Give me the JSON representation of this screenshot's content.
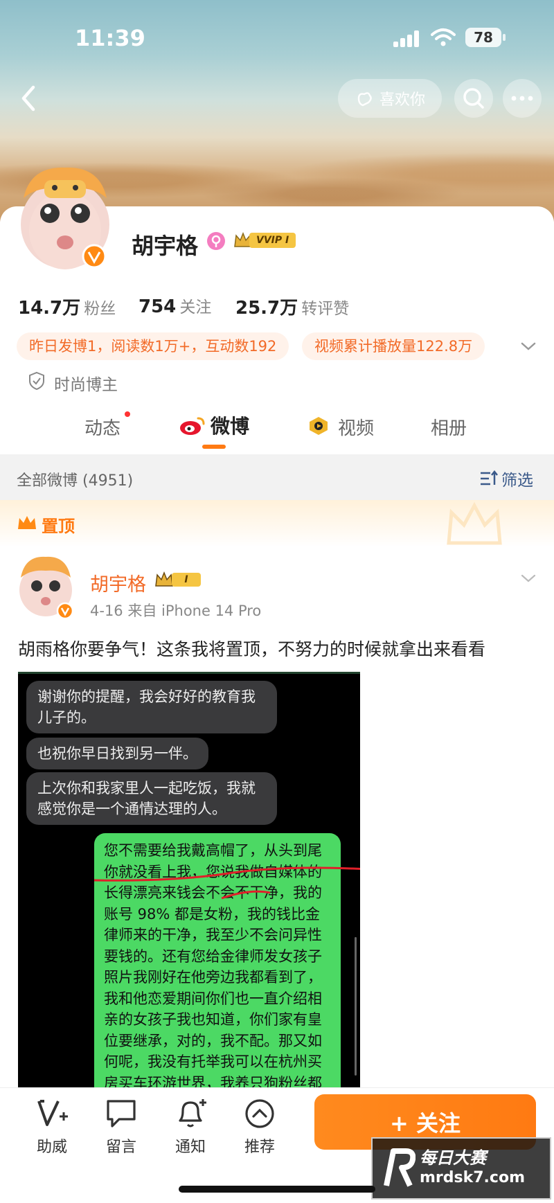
{
  "status_bar": {
    "time": "11:39",
    "battery": "78"
  },
  "header": {
    "like_label": "喜欢你"
  },
  "profile": {
    "name": "胡宇格",
    "vip_badge": "VVIP I",
    "stats": [
      {
        "num": "14.7万",
        "label": "粉丝"
      },
      {
        "num": "754",
        "label": "关注"
      },
      {
        "num": "25.7万",
        "label": "转评赞"
      }
    ],
    "pills": [
      "昨日发博1，阅读数1万+，互动数192",
      "视频累计播放量122.8万"
    ],
    "tag": "时尚博主"
  },
  "tabs": [
    "动态",
    "微博",
    "视频",
    "相册"
  ],
  "filter": {
    "count_label": "全部微博 (4951)",
    "filter_label": "筛选"
  },
  "pinned_label": "置顶",
  "post": {
    "author": "胡宇格",
    "badge": "I",
    "meta": "4-16  来自 iPhone 14 Pro",
    "text": "胡雨格你要争气！这条我将置顶，不努力的时候就拿出来看看"
  },
  "chat": {
    "gray_bubbles": [
      "谢谢你的提醒，我会好好的教育我儿子的。",
      "也祝你早日找到另一伴。",
      "上次你和我家里人一起吃饭，我就感觉你是一个通情达理的人。"
    ],
    "green_bubble": "您不需要给我戴高帽了，从头到尾你就没看上我，您说我做自媒体的长得漂亮来钱会不会不干净，我的账号 98% 都是女粉，我的钱比金律师来的干净，我至少不会问异性要钱的。还有您给金律师发女孩子照片我刚好在他旁边我都看到了，我和他恋爱期间你们也一直介绍相亲的女孩子我也知道，你们家有皇位要继承，对的，我不配。那又如何呢，我没有托举我可以在杭州买房买车环游世界，我养只狗粉丝都比金律师全网加起来多，我就是让金律师三年我也比他厉害。您祝我"
  },
  "bottom_bar": {
    "items": [
      "助威",
      "留言",
      "通知",
      "推荐"
    ],
    "follow_label": "+ 关注"
  },
  "watermark": {
    "line1": "每日大赛",
    "line2": "mrdsk7.com"
  },
  "colors": {
    "accent": "#ff7a12",
    "green_bubble": "#4cd964"
  }
}
